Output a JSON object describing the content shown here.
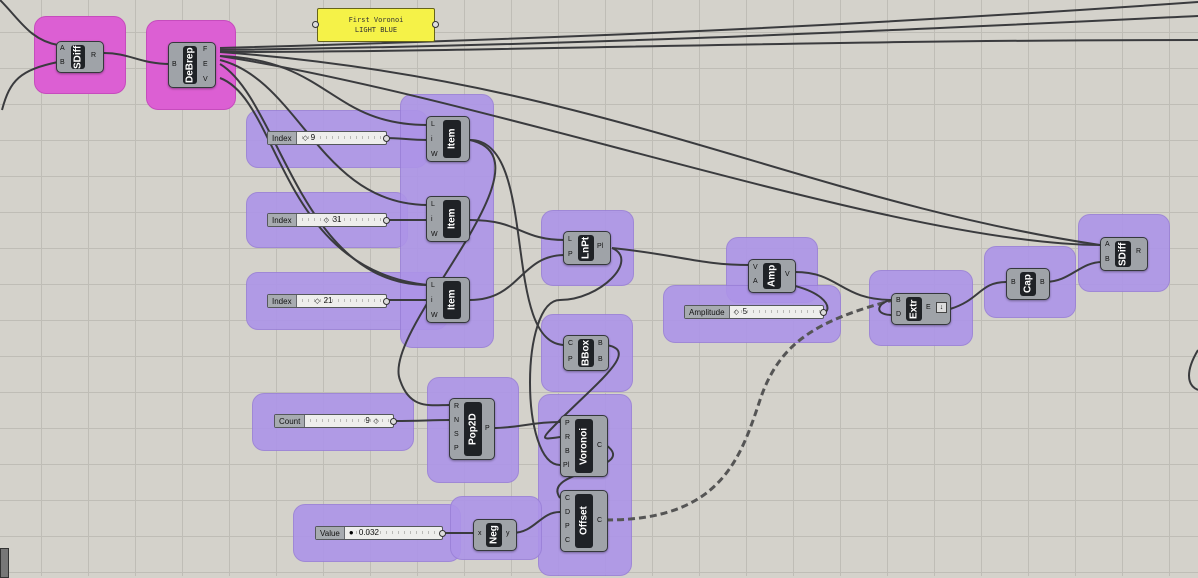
{
  "panel": {
    "line1": "First Voronoi",
    "line2": "LIGHT BLUE"
  },
  "components": {
    "sdiff1": {
      "nick": "SDiff",
      "inputs": [
        "A",
        "B"
      ],
      "outputs": [
        "R"
      ]
    },
    "debrep": {
      "nick": "DeBrep",
      "inputs": [
        "B"
      ],
      "outputs": [
        "F",
        "E",
        "V"
      ]
    },
    "item1": {
      "nick": "Item",
      "inputs": [
        "L",
        "i",
        "W"
      ]
    },
    "item2": {
      "nick": "Item",
      "inputs": [
        "L",
        "i",
        "W"
      ]
    },
    "item3": {
      "nick": "Item",
      "inputs": [
        "L",
        "i",
        "W"
      ]
    },
    "lnpt": {
      "nick": "LnPt",
      "inputs": [
        "L",
        "P"
      ],
      "outputs": [
        "Pl"
      ]
    },
    "bbox": {
      "nick": "BBox",
      "inputs": [
        "C",
        "P"
      ],
      "outputs": [
        "B",
        "B"
      ]
    },
    "pop2d": {
      "nick": "Pop2D",
      "inputs": [
        "R",
        "N",
        "S",
        "P"
      ],
      "outputs": [
        "P"
      ]
    },
    "voronoi": {
      "nick": "Voronoi",
      "inputs": [
        "P",
        "R",
        "B",
        "Pl"
      ],
      "outputs": [
        "C"
      ]
    },
    "offset": {
      "nick": "Offset",
      "inputs": [
        "C",
        "D",
        "P",
        "C"
      ],
      "outputs": [
        "C"
      ]
    },
    "neg": {
      "nick": "Neg",
      "inputs": [
        "x"
      ],
      "outputs": [
        "y"
      ]
    },
    "amp": {
      "nick": "Amp",
      "inputs": [
        "V",
        "A"
      ],
      "outputs": [
        "V"
      ]
    },
    "extr": {
      "nick": "Extr",
      "inputs": [
        "B",
        "D"
      ],
      "outputs": [
        "E"
      ]
    },
    "cap": {
      "nick": "Cap",
      "inputs": [
        "B"
      ],
      "outputs": [
        "B"
      ]
    },
    "sdiff2": {
      "nick": "SDiff",
      "inputs": [
        "A",
        "B"
      ],
      "outputs": [
        "R"
      ]
    }
  },
  "sliders": {
    "index1": {
      "label": "Index",
      "value": "9",
      "fraction": 0.0
    },
    "index2": {
      "label": "Index",
      "value": "31",
      "fraction": 0.3
    },
    "index3": {
      "label": "Index",
      "value": "21",
      "fraction": 0.2
    },
    "count": {
      "label": "Count",
      "value": "9",
      "fraction": 0.95
    },
    "value": {
      "label": "Value",
      "value": "0.032",
      "fraction": 0.0
    },
    "amplitude": {
      "label": "Amplitude",
      "value": "5",
      "fraction": 0.0
    }
  },
  "colors": {
    "group_purple": "#ad94e8",
    "group_pink": "#dc5fd3",
    "canvas": "#d4d2cb",
    "panel_yellow": "#f5f248"
  }
}
